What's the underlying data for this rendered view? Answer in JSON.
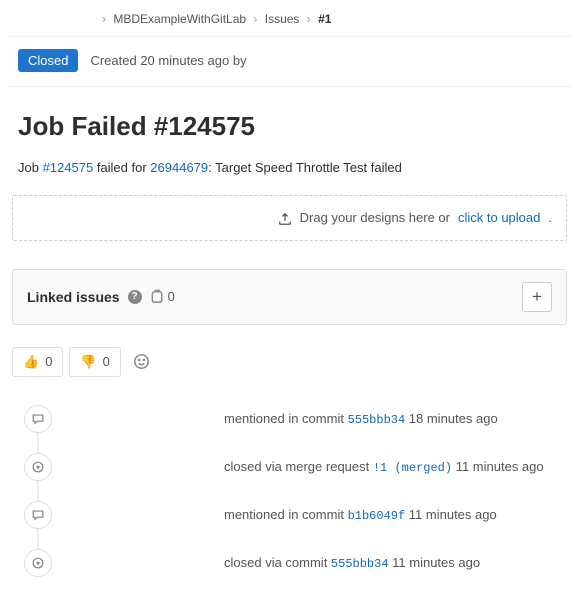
{
  "breadcrumb": {
    "project": "MBDExampleWithGitLab",
    "section": "Issues",
    "current": "#1"
  },
  "status": {
    "badge": "Closed",
    "created": "Created 20 minutes ago by"
  },
  "title": "Job Failed #124575",
  "desc": {
    "pre": "Job ",
    "job_link": "#124575",
    "mid": " failed for ",
    "commit_link": "26944679",
    "post": ": Target Speed Throttle Test failed"
  },
  "dropzone": {
    "text": "Drag your designs here or ",
    "link": "click to upload",
    "tail": "."
  },
  "linked": {
    "title": "Linked issues",
    "count": "0",
    "add": "+"
  },
  "reactions": {
    "thumbsup": {
      "emoji": "👍",
      "count": "0"
    },
    "thumbsdown": {
      "emoji": "👎",
      "count": "0"
    }
  },
  "timeline": [
    {
      "type": "comment",
      "pre": "mentioned in commit ",
      "ref": "555bbb34",
      "time": " 18 minutes ago"
    },
    {
      "type": "status",
      "pre": "closed via merge request ",
      "ref": "!1 (merged)",
      "time": " 11 minutes ago"
    },
    {
      "type": "comment",
      "pre": "mentioned in commit ",
      "ref": "b1b6049f",
      "time": " 11 minutes ago"
    },
    {
      "type": "status",
      "pre": "closed via commit ",
      "ref": "555bbb34",
      "time": " 11 minutes ago"
    }
  ]
}
